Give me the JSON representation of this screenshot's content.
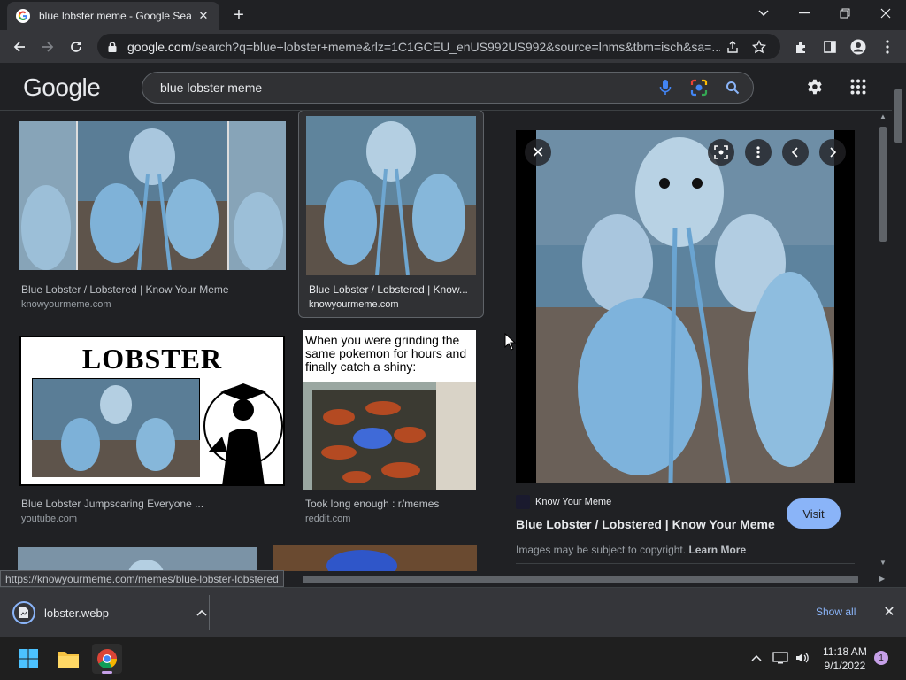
{
  "browser": {
    "tab_title": "blue lobster meme - Google Sear",
    "url_domain": "google.com",
    "url_rest": "/search?q=blue+lobster+meme&rlz=1C1GCEU_enUS992US992&source=lnms&tbm=isch&sa=..."
  },
  "google": {
    "logo": "Google",
    "query": "blue lobster meme"
  },
  "results": [
    {
      "title": "Blue Lobster / Lobstered | Know Your Meme",
      "source": "knowyourmeme.com"
    },
    {
      "title": "Blue Lobster / Lobstered | Know...",
      "source": "knowyourmeme.com"
    },
    {
      "title": "Blue Lobster Jumpscaring Everyone ...",
      "source": "youtube.com",
      "image_text": "LOBSTER"
    },
    {
      "title": "Took long enough : r/memes",
      "source": "reddit.com",
      "image_text": "When you were grinding the same pokemon for hours and finally catch a shiny:"
    }
  ],
  "preview": {
    "source_name": "Know Your Meme",
    "title": "Blue Lobster / Lobstered | Know Your Meme",
    "visit_label": "Visit",
    "copyright_text": "Images may be subject to copyright.",
    "learn_more": "Learn More"
  },
  "status_url": "https://knowyourmeme.com/memes/blue-lobster-lobstered",
  "download": {
    "filename": "lobster.webp",
    "show_all": "Show all"
  },
  "taskbar": {
    "time": "11:18 AM",
    "date": "9/1/2022",
    "notifications": "1"
  },
  "colors": {
    "accent": "#8ab4f8",
    "background": "#202124",
    "toolbar": "#35363a"
  }
}
